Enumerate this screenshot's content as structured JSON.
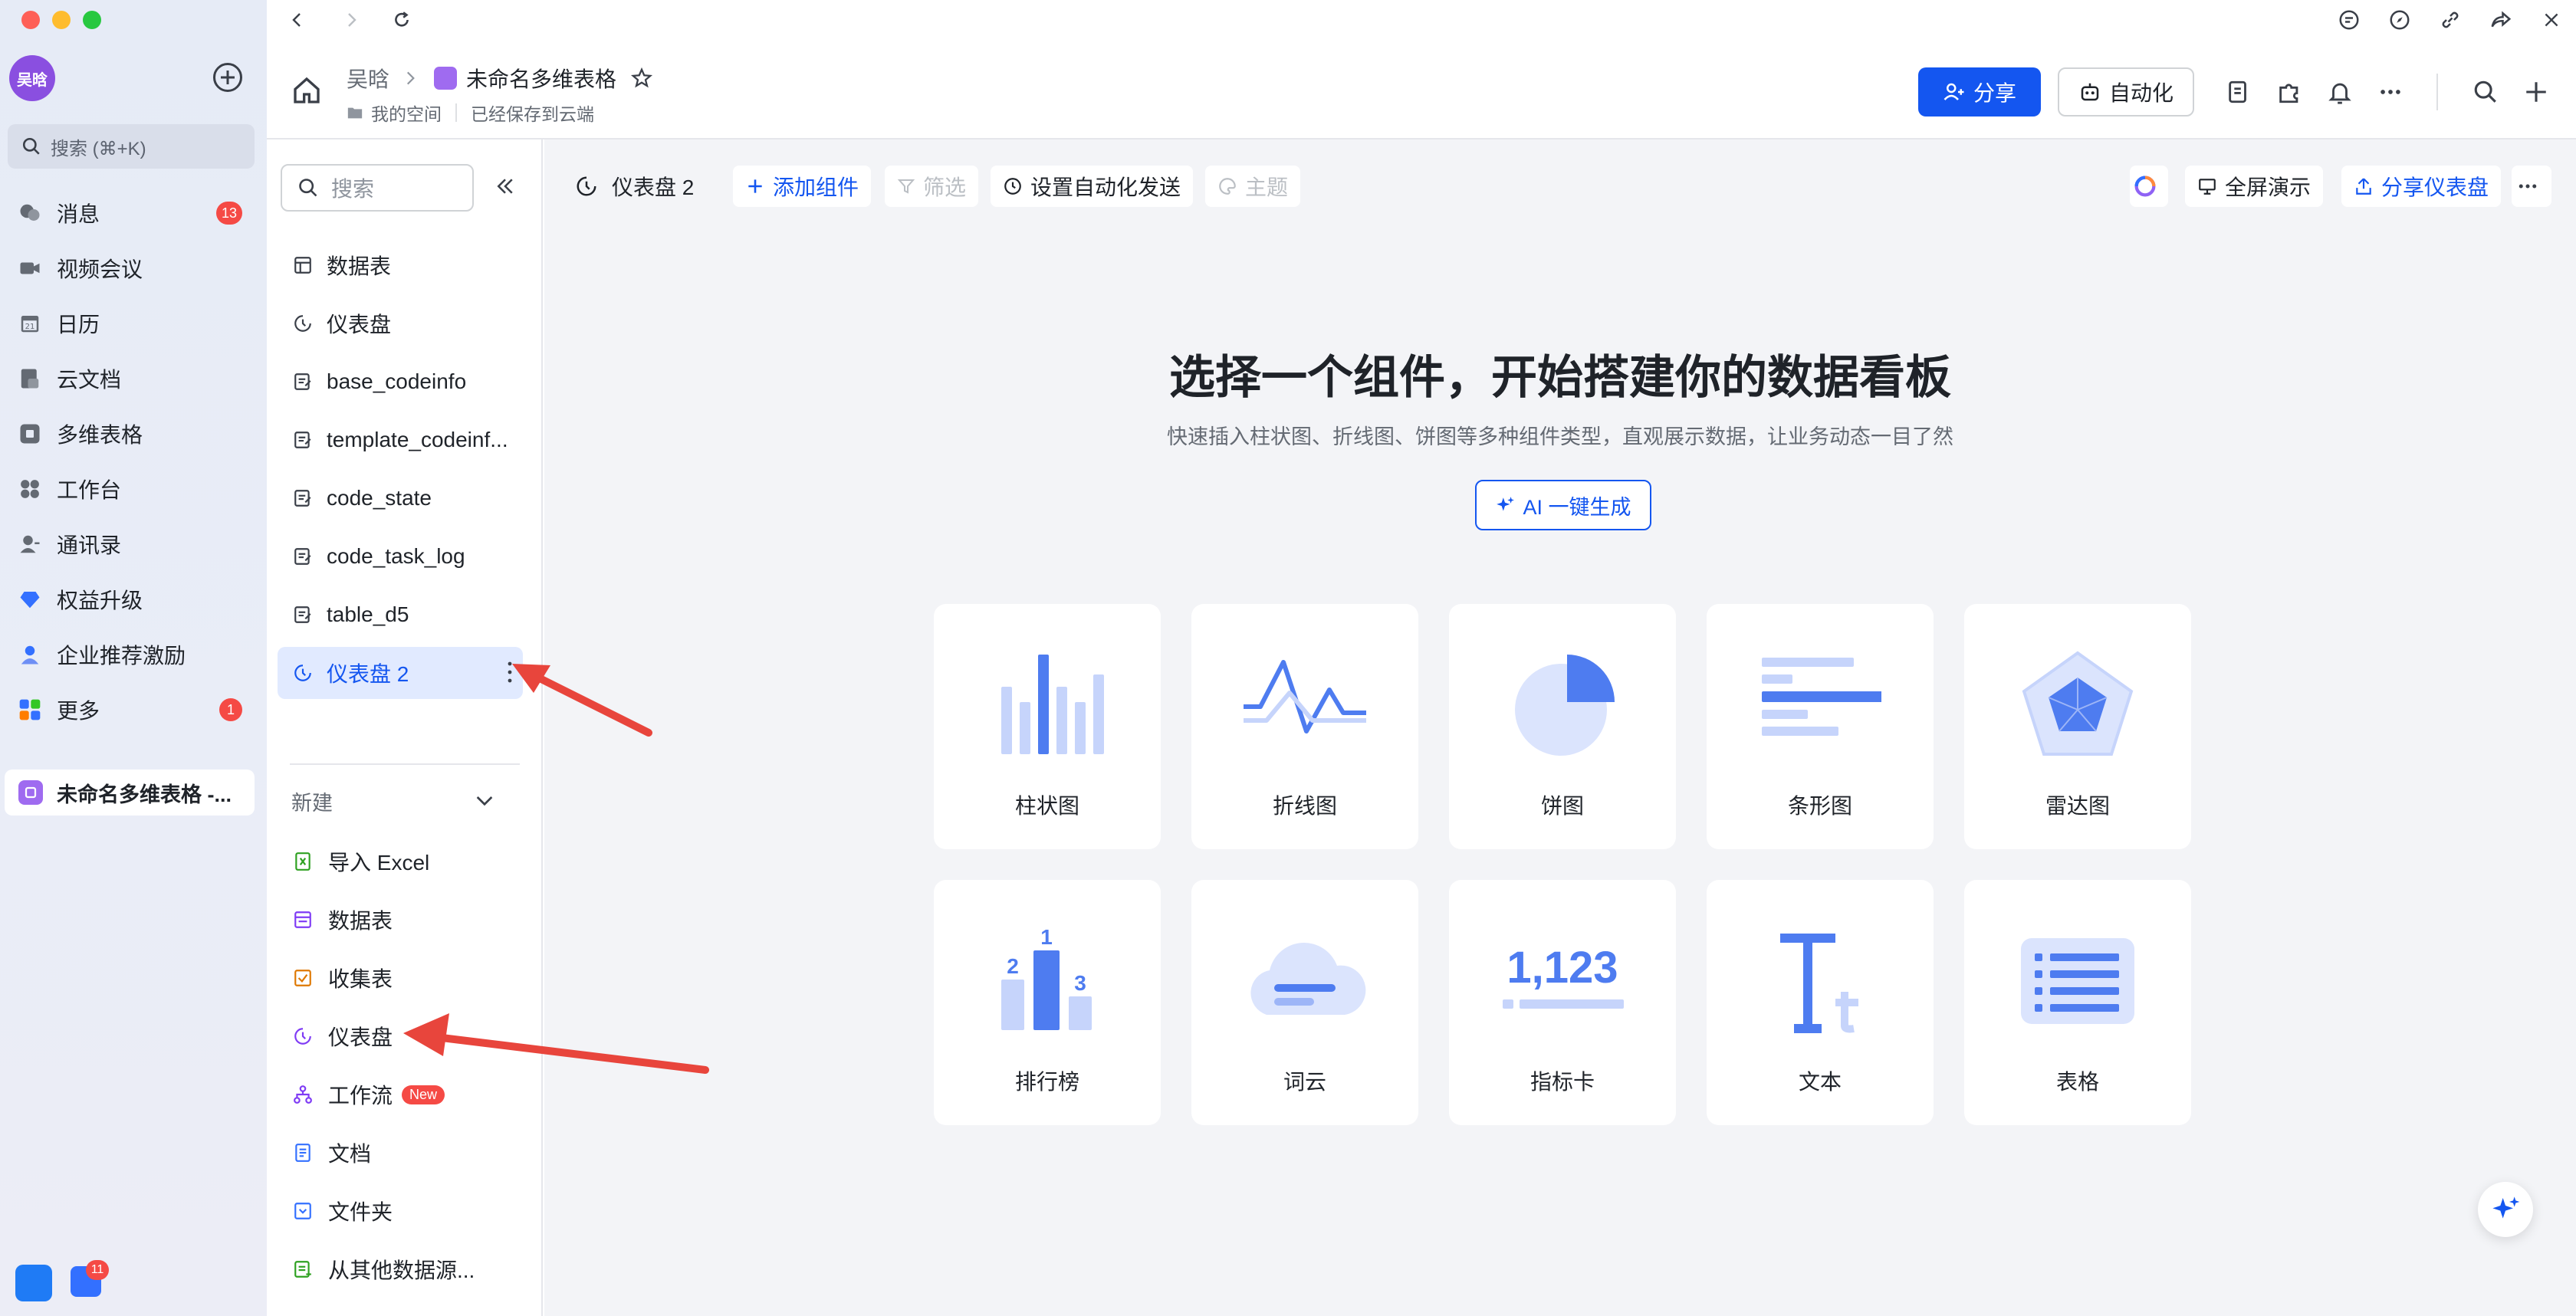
{
  "app_sidebar": {
    "avatar_text": "吴晗",
    "search_placeholder": "搜索 (⌘+K)",
    "items": [
      {
        "label": "消息",
        "icon": "chat-bubble-icon",
        "badge": "13"
      },
      {
        "label": "视频会议",
        "icon": "video-camera-icon",
        "badge": ""
      },
      {
        "label": "日历",
        "icon": "calendar-icon",
        "badge": ""
      },
      {
        "label": "云文档",
        "icon": "cloud-doc-icon",
        "badge": ""
      },
      {
        "label": "多维表格",
        "icon": "base-table-icon",
        "badge": ""
      },
      {
        "label": "工作台",
        "icon": "workplace-grid-icon",
        "badge": ""
      },
      {
        "label": "通讯录",
        "icon": "contacts-icon",
        "badge": ""
      },
      {
        "label": "权益升级",
        "icon": "diamond-icon",
        "badge": ""
      },
      {
        "label": "企业推荐激励",
        "icon": "referral-person-icon",
        "badge": ""
      },
      {
        "label": "更多",
        "icon": "more-apps-icon",
        "badge": "1"
      }
    ],
    "current_doc": "未命名多维表格 -...",
    "bottom_badge": "11"
  },
  "header": {
    "breadcrumb_owner": "吴晗",
    "doc_title": "未命名多维表格",
    "location": "我的空间",
    "save_status": "已经保存到云端",
    "share_label": "分享",
    "automation_label": "自动化"
  },
  "tables_panel": {
    "search_placeholder": "搜索",
    "items": [
      {
        "label": "数据表",
        "icon": "grid-table-icon"
      },
      {
        "label": "仪表盘",
        "icon": "dashboard-gauge-icon"
      },
      {
        "label": "base_codeinfo",
        "icon": "form-table-icon"
      },
      {
        "label": "template_codeinf...",
        "icon": "form-table-icon"
      },
      {
        "label": "code_state",
        "icon": "form-table-icon"
      },
      {
        "label": "code_task_log",
        "icon": "form-table-icon"
      },
      {
        "label": "table_d5",
        "icon": "form-table-icon"
      },
      {
        "label": "仪表盘 2",
        "icon": "dashboard-gauge-icon"
      }
    ],
    "new_section_label": "新建",
    "new_items": [
      {
        "label": "导入 Excel",
        "icon": "excel-icon",
        "color": "#2ea121",
        "tag": ""
      },
      {
        "label": "数据表",
        "icon": "grid-table-icon",
        "color": "#7f3bf5",
        "tag": ""
      },
      {
        "label": "收集表",
        "icon": "form-collect-icon",
        "color": "#de7802",
        "tag": ""
      },
      {
        "label": "仪表盘",
        "icon": "dashboard-gauge-icon",
        "color": "#7f3bf5",
        "tag": ""
      },
      {
        "label": "工作流",
        "icon": "workflow-icon",
        "color": "#7f3bf5",
        "tag": "New"
      },
      {
        "label": "文档",
        "icon": "document-icon",
        "color": "#3370ff",
        "tag": ""
      },
      {
        "label": "文件夹",
        "icon": "folder-icon",
        "color": "#3370ff",
        "tag": ""
      },
      {
        "label": "从其他数据源...",
        "icon": "data-source-icon",
        "color": "#2ea121",
        "tag": ""
      }
    ]
  },
  "toolbar": {
    "tab_name": "仪表盘 2",
    "add_widget": "添加组件",
    "filter": "筛选",
    "auto_send": "设置自动化发送",
    "theme": "主题",
    "fullscreen": "全屏演示",
    "share_dashboard": "分享仪表盘"
  },
  "hero": {
    "title": "选择一个组件，开始搭建你的数据看板",
    "subtitle": "快速插入柱状图、折线图、饼图等多种组件类型，直观展示数据，让业务动态一目了然",
    "ai_button": "AI 一键生成"
  },
  "widgets": [
    {
      "label": "柱状图",
      "icon": "bar-chart-icon"
    },
    {
      "label": "折线图",
      "icon": "line-chart-icon"
    },
    {
      "label": "饼图",
      "icon": "pie-chart-icon"
    },
    {
      "label": "条形图",
      "icon": "horizontal-bar-icon"
    },
    {
      "label": "雷达图",
      "icon": "radar-chart-icon"
    },
    {
      "label": "排行榜",
      "icon": "ranking-podium-icon",
      "digits": [
        "2",
        "1",
        "3"
      ]
    },
    {
      "label": "词云",
      "icon": "word-cloud-icon"
    },
    {
      "label": "指标卡",
      "icon": "metric-card-icon",
      "number": "1,123"
    },
    {
      "label": "文本",
      "icon": "text-icon"
    },
    {
      "label": "表格",
      "icon": "table-icon"
    }
  ],
  "colors": {
    "accent": "#1456f0",
    "illus_dark": "#4e7cf0",
    "illus_light": "#c6d4fb",
    "annotation_arrow": "#e8453c"
  }
}
